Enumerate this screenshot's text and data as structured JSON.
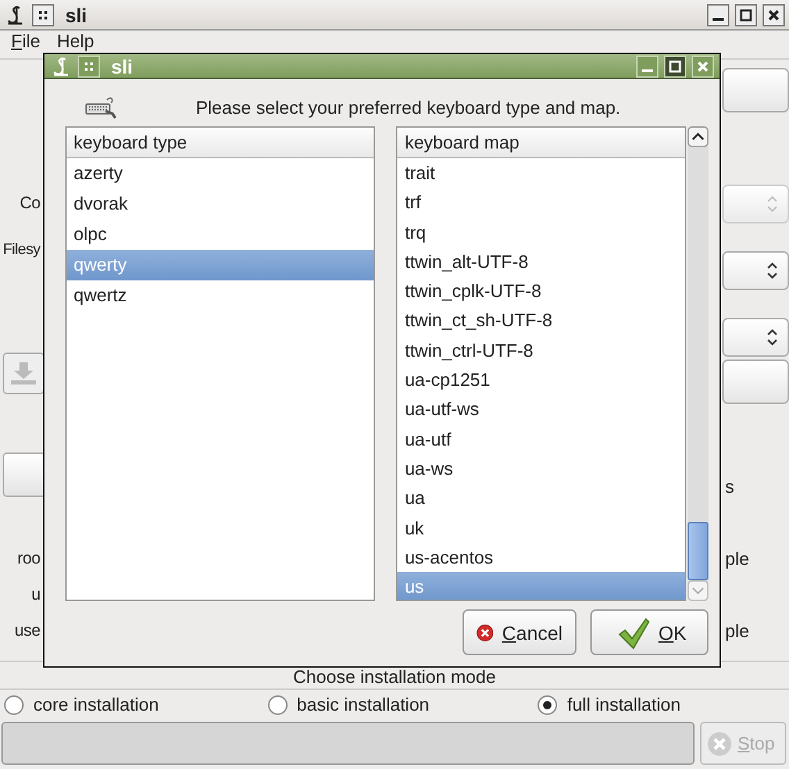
{
  "main_window": {
    "title": "sli",
    "menu": [
      {
        "accel": "F",
        "rest": "ile"
      },
      {
        "rest": "Help"
      }
    ],
    "progress": {
      "level": 0
    },
    "left_labels": [
      "Co",
      "Filesy",
      "roo",
      "u",
      "use"
    ],
    "right_labels": [
      "s",
      "ple",
      "ple"
    ],
    "install_mode": {
      "title": "Choose installation mode",
      "options": [
        {
          "label": "core installation",
          "selected": false
        },
        {
          "label": "basic installation",
          "selected": false
        },
        {
          "label": "full installation",
          "selected": true
        }
      ]
    },
    "stop_button": {
      "accel": "S",
      "rest": "top",
      "disabled": true
    }
  },
  "dialog": {
    "title": "sli",
    "instruction": "Please select your preferred keyboard type and map.",
    "keyboard_type": {
      "header": "keyboard type",
      "items": [
        {
          "label": "azerty",
          "selected": false
        },
        {
          "label": "dvorak",
          "selected": false
        },
        {
          "label": "olpc",
          "selected": false
        },
        {
          "label": "qwerty",
          "selected": true
        },
        {
          "label": "qwertz",
          "selected": false
        }
      ]
    },
    "keyboard_map": {
      "header": "keyboard map",
      "items": [
        {
          "label": "trait",
          "selected": false
        },
        {
          "label": "trf",
          "selected": false
        },
        {
          "label": "trq",
          "selected": false
        },
        {
          "label": "ttwin_alt-UTF-8",
          "selected": false
        },
        {
          "label": "ttwin_cplk-UTF-8",
          "selected": false
        },
        {
          "label": "ttwin_ct_sh-UTF-8",
          "selected": false
        },
        {
          "label": "ttwin_ctrl-UTF-8",
          "selected": false
        },
        {
          "label": "ua-cp1251",
          "selected": false
        },
        {
          "label": "ua-utf-ws",
          "selected": false
        },
        {
          "label": "ua-utf",
          "selected": false
        },
        {
          "label": "ua-ws",
          "selected": false
        },
        {
          "label": "ua",
          "selected": false
        },
        {
          "label": "uk",
          "selected": false
        },
        {
          "label": "us-acentos",
          "selected": false
        },
        {
          "label": "us",
          "selected": true
        }
      ]
    },
    "cancel_button": {
      "accel": "C",
      "rest": "ancel"
    },
    "ok_button": {
      "accel": "O",
      "rest": "K"
    }
  }
}
